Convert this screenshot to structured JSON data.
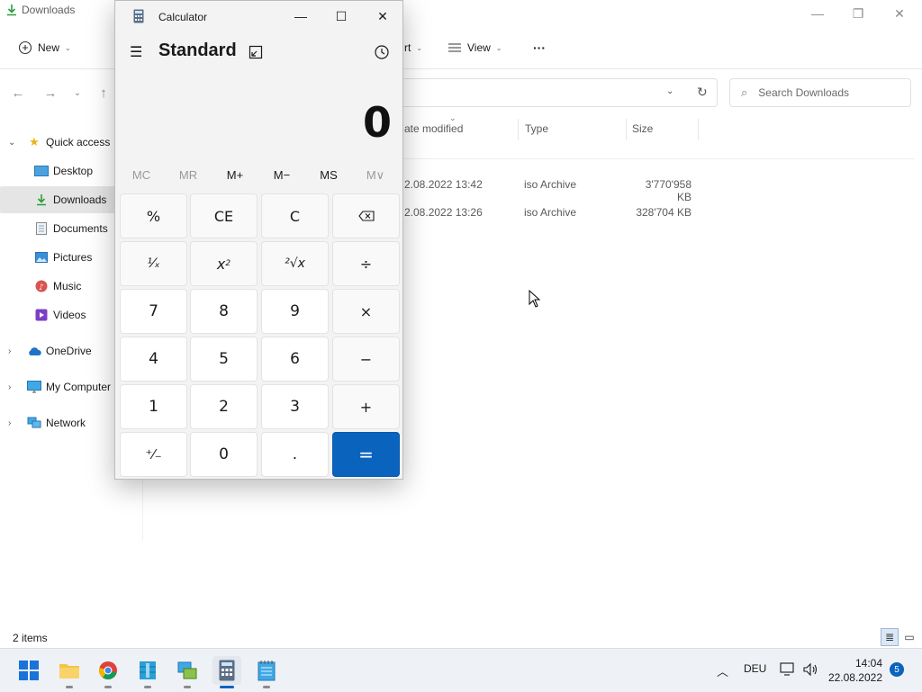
{
  "explorer": {
    "title": "Downloads",
    "toolbar": {
      "new_label": "New",
      "sort_label_partial": "rt",
      "view_label": "View",
      "more_label": "···"
    },
    "search_placeholder": "Search Downloads",
    "sidebar": {
      "items": [
        {
          "label": "Quick access",
          "icon": "star-icon"
        },
        {
          "label": "Desktop",
          "icon": "desktop-icon"
        },
        {
          "label": "Downloads",
          "icon": "download-icon",
          "selected": true
        },
        {
          "label": "Documents",
          "icon": "documents-icon"
        },
        {
          "label": "Pictures",
          "icon": "pictures-icon"
        },
        {
          "label": "Music",
          "icon": "music-icon"
        },
        {
          "label": "Videos",
          "icon": "videos-icon"
        },
        {
          "label": "OneDrive",
          "icon": "cloud-icon"
        },
        {
          "label": "My Computer",
          "icon": "computer-icon"
        },
        {
          "label": "Network",
          "icon": "network-icon"
        }
      ]
    },
    "columns": {
      "date_modified": "ate modified",
      "type": "Type",
      "size": "Size"
    },
    "files": [
      {
        "date": "2.08.2022 13:42",
        "type": "iso Archive",
        "size": "3'770'958 KB"
      },
      {
        "date": "2.08.2022 13:26",
        "type": "iso Archive",
        "size": "328'704 KB"
      }
    ],
    "status": "2 items"
  },
  "calculator": {
    "title": "Calculator",
    "mode": "Standard",
    "display": "0",
    "memory_buttons": [
      "MC",
      "MR",
      "M+",
      "M−",
      "MS",
      "M∨"
    ],
    "keys": [
      "%",
      "CE",
      "C",
      "⌫",
      "¹⁄ₓ",
      "x",
      "²√x",
      "÷",
      "7",
      "8",
      "9",
      "×",
      "4",
      "5",
      "6",
      "−",
      "1",
      "2",
      "3",
      "+",
      "⁺⁄₋",
      "0",
      ".",
      "="
    ]
  },
  "taskbar": {
    "language": "DEU",
    "time": "14:04",
    "date": "22.08.2022",
    "notifications": "5",
    "accent": "#0a63bd"
  }
}
